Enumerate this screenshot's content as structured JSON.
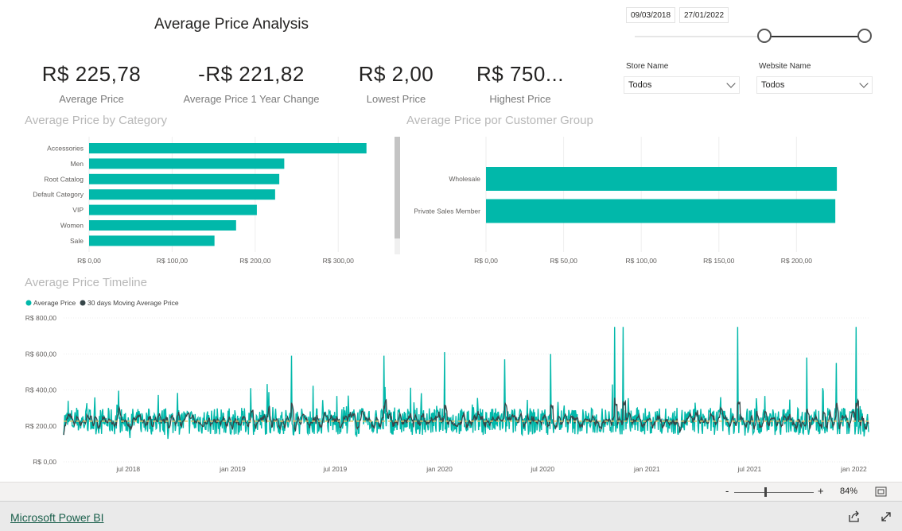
{
  "title": "Average Price Analysis",
  "date_range": {
    "start": "09/03/2018",
    "end": "27/01/2022"
  },
  "filters": {
    "store": {
      "label": "Store Name",
      "value": "Todos"
    },
    "website": {
      "label": "Website Name",
      "value": "Todos"
    }
  },
  "kpis": [
    {
      "value": "R$ 225,78",
      "label": "Average Price"
    },
    {
      "value": "-R$ 221,82",
      "label": "Average Price 1 Year Change"
    },
    {
      "value": "R$ 2,00",
      "label": "Lowest Price"
    },
    {
      "value": "R$ 750...",
      "label": "Highest Price"
    }
  ],
  "zoom": {
    "minus": "-",
    "plus": "+",
    "level": "84%"
  },
  "footer": {
    "link": "Microsoft Power BI"
  },
  "colors": {
    "teal": "#01b8aa",
    "dark": "#374649"
  },
  "icons": [
    "fit-to-page-icon",
    "share-icon",
    "expand-icon"
  ],
  "chart_data": [
    {
      "type": "bar",
      "title": "Average Price by Category",
      "categories": [
        "Accessories",
        "Men",
        "Root Catalog",
        "Default Category",
        "VIP",
        "Women",
        "Sale"
      ],
      "values": [
        334,
        235,
        229,
        224,
        202,
        177,
        151
      ],
      "xlim": [
        0,
        340
      ],
      "ticks": [
        "R$ 0,00",
        "R$ 100,00",
        "R$ 200,00",
        "R$ 300,00"
      ],
      "tick_values": [
        0,
        100,
        200,
        300
      ],
      "grid": true
    },
    {
      "type": "bar",
      "title": "Average Price por Customer Group",
      "categories": [
        "Wholesale",
        "Private Sales Member"
      ],
      "values": [
        226,
        225
      ],
      "xlim": [
        0,
        228
      ],
      "ticks": [
        "R$ 0,00",
        "R$ 50,00",
        "R$ 100,00",
        "R$ 150,00",
        "R$ 200,00"
      ],
      "tick_values": [
        0,
        50,
        100,
        150,
        200
      ],
      "grid": true
    },
    {
      "type": "line",
      "title": "Average Price Timeline",
      "series": [
        {
          "name": "Average Price",
          "color": "#01b8aa"
        },
        {
          "name": "30 days Moving Average Price",
          "color": "#374649"
        }
      ],
      "y_ticks": [
        "R$ 0,00",
        "R$ 200,00",
        "R$ 400,00",
        "R$ 600,00",
        "R$ 800,00"
      ],
      "y_tick_values": [
        0,
        200,
        400,
        600,
        800
      ],
      "ylim": [
        0,
        800
      ],
      "x_ticks": [
        "jul 2018",
        "jan 2019",
        "jul 2019",
        "jan 2020",
        "jul 2020",
        "jan 2021",
        "jul 2021",
        "jan 2022"
      ],
      "x_tick_values": [
        "2018-07-01",
        "2019-01-01",
        "2019-07-01",
        "2020-01-01",
        "2020-07-01",
        "2021-01-01",
        "2021-07-01",
        "2022-01-01"
      ],
      "x_range": [
        "2018-03-09",
        "2022-01-27"
      ],
      "reference_line": 225.78,
      "spikes": [
        {
          "date": "2019-04-15",
          "value": 590
        },
        {
          "date": "2019-09-25",
          "value": 590
        },
        {
          "date": "2020-01-10",
          "value": 610
        },
        {
          "date": "2020-04-25",
          "value": 570
        },
        {
          "date": "2020-07-15",
          "value": 600
        },
        {
          "date": "2020-11-05",
          "value": 750
        },
        {
          "date": "2020-11-20",
          "value": 750
        },
        {
          "date": "2021-06-10",
          "value": 750
        },
        {
          "date": "2021-10-10",
          "value": 580
        },
        {
          "date": "2021-12-01",
          "value": 550
        },
        {
          "date": "2022-01-05",
          "value": 750
        }
      ]
    }
  ]
}
